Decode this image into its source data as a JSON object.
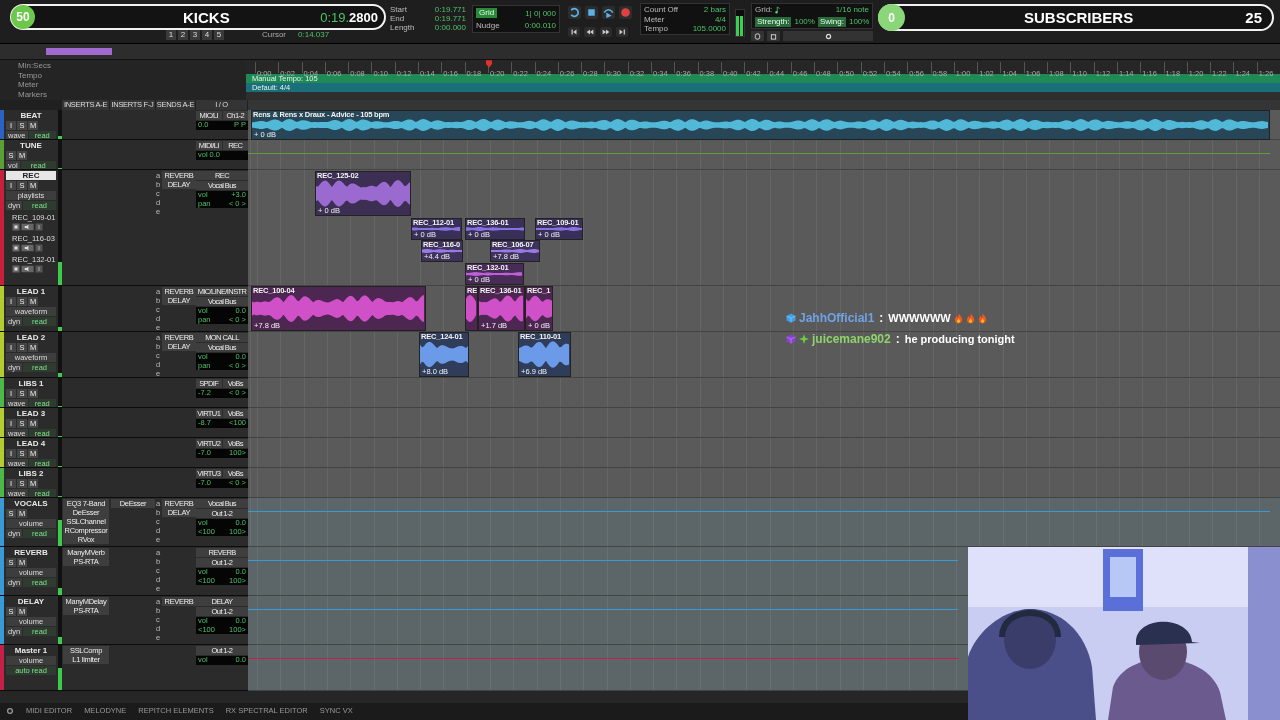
{
  "toolbar": {
    "edit_tools": [
      "1",
      "2",
      "3",
      "4",
      "5"
    ],
    "counter": {
      "main": "0:19.",
      "fraction": "2800"
    },
    "cursor": {
      "label": "Cursor",
      "value": "0:14.037"
    },
    "selection": [
      {
        "label": "Start",
        "value": "0:19.771"
      },
      {
        "label": "End",
        "value": "0:19.771"
      },
      {
        "label": "Length",
        "value": "0:00.000"
      }
    ],
    "grid": {
      "label": "Grid",
      "value": "1| 0| 000"
    },
    "nudge": {
      "label": "Nudge",
      "value": "0:00.010"
    },
    "count_off": [
      {
        "label": "Count Off",
        "value": "2 bars"
      },
      {
        "label": "Meter",
        "value": "4/4"
      },
      {
        "label": "Tempo",
        "value": "105.0000"
      }
    ],
    "level": 0.78,
    "midi_grid": {
      "label": "Grid:",
      "value": "1/16 note"
    },
    "strength": {
      "label": "Strength:",
      "value": "100%"
    },
    "swing": {
      "label": "Swing:",
      "value": "100%"
    }
  },
  "stream_overlay": {
    "goal_count": "50",
    "goal_label": "KICKS",
    "subs_count": "0",
    "subs_label": "SUBSCRIBERS",
    "subs_goal": "25"
  },
  "ruler": {
    "labels": [
      "Min:Secs",
      "Tempo",
      "Meter",
      "Markers"
    ],
    "ticks": [
      "0:00",
      "0:02",
      "0:04",
      "0:06",
      "0:08",
      "0:10",
      "0:12",
      "0:14",
      "0:16",
      "0:18",
      "0:20",
      "0:22",
      "0:24",
      "0:26",
      "0:28",
      "0:30",
      "0:32",
      "0:34",
      "0:36",
      "0:38",
      "0:40",
      "0:42",
      "0:44",
      "0:46",
      "0:48",
      "0:50",
      "0:52",
      "0:54",
      "0:56",
      "0:58",
      "1:00",
      "1:02",
      "1:04",
      "1:06",
      "1:08",
      "1:10",
      "1:12",
      "1:14",
      "1:16",
      "1:18",
      "1:20",
      "1:22",
      "1:24",
      "1:26"
    ],
    "tempo": "Manual Tempo: 105",
    "meter": "Default: 4/4"
  },
  "columns": [
    "INSERTS A-E",
    "INSERTS F-J",
    "SENDS A-E",
    "I / O"
  ],
  "tracks": [
    {
      "name": "BEAT",
      "color": "#2b63c4",
      "kind": "compact",
      "selected": false,
      "level": 0.1,
      "buttons": [
        "I",
        "S",
        "M"
      ],
      "view": "wave",
      "automation": "read",
      "input": "MIC/LI",
      "output": "Ch1-2",
      "readouts": [
        {
          "value": "0.0"
        },
        {
          "value": "P P"
        }
      ],
      "clips": [
        {
          "name": "Rens & Rens x Draux - Advice - 105 bpm",
          "gain": "+ 0 dB",
          "color": "#52b8d8"
        }
      ]
    },
    {
      "name": "TUNE",
      "color": "#5aa032",
      "kind": "compact",
      "selected": false,
      "level": 0.05,
      "buttons": [
        "S",
        "M"
      ],
      "view": "vol",
      "automation": "read",
      "input": "MIDI/LI",
      "output": "REC",
      "readouts": [
        {
          "label": "vol",
          "value": "0.0"
        }
      ],
      "volume_line": true
    },
    {
      "name": "REC",
      "color": "#c8203c",
      "kind": "full",
      "selected": true,
      "level": 0.2,
      "buttons": [
        "I",
        "S",
        "M"
      ],
      "view": "playlists",
      "dyn": "dyn",
      "automation": "read",
      "sends": [
        {
          "slot": "a",
          "name": "REVERB"
        },
        {
          "slot": "b",
          "name": "DELAY"
        },
        {
          "slot": "c"
        },
        {
          "slot": "d"
        },
        {
          "slot": "e"
        }
      ],
      "input": "REC",
      "output": "Vocal Bus",
      "readouts": [
        {
          "label": "vol",
          "value": "+3.0"
        },
        {
          "label": "pan",
          "value": "< 0 >"
        }
      ],
      "playlists": [
        "REC_109-01",
        "REC_116-03",
        "REC_132-01"
      ],
      "clips": [
        {
          "name": "REC_125-02",
          "gain": "+ 0 dB",
          "color": "#9a6ad0"
        },
        {
          "name": "REC_112-01",
          "gain": "+ 0 dB",
          "color": "#8a70e0"
        },
        {
          "name": "REC_136-01",
          "gain": "+ 0 dB",
          "color": "#8a70e0"
        },
        {
          "name": "REC_109-01",
          "gain": "+ 0 dB",
          "color": "#8a70e0"
        },
        {
          "name": "REC_116-0",
          "gain": "+4.4 dB",
          "color": "#9a78e8"
        },
        {
          "name": "REC_106-07",
          "gain": "+7.8 dB",
          "color": "#9a78e8"
        },
        {
          "name": "REC_132-01",
          "gain": "+ 0 dB",
          "color": "#c060d8"
        }
      ]
    },
    {
      "name": "LEAD 1",
      "color": "#b4cc30",
      "kind": "full",
      "selected": false,
      "level": 0.1,
      "buttons": [
        "I",
        "S",
        "M"
      ],
      "view": "waveform",
      "dyn": "dyn",
      "automation": "read",
      "sends": [
        {
          "slot": "a",
          "name": "REVERB"
        },
        {
          "slot": "b",
          "name": "DELAY"
        },
        {
          "slot": "c"
        },
        {
          "slot": "d"
        },
        {
          "slot": "e"
        }
      ],
      "input": "MIC/LINE/INSTR",
      "output": "Vocal Bus",
      "readouts": [
        {
          "label": "vol",
          "value": "0.0"
        },
        {
          "label": "pan",
          "value": "< 0 >"
        }
      ],
      "clips": [
        {
          "name": "REC_100-04",
          "gain": "+7.8 dB",
          "color": "#d050c8"
        },
        {
          "name": "RE",
          "color": "#d050c8"
        },
        {
          "name": "REC_136-01",
          "gain": "+1.7 dB",
          "color": "#d050c8"
        },
        {
          "name": "REC_1",
          "gain": "+ 0 dB",
          "color": "#d050c8"
        }
      ]
    },
    {
      "name": "LEAD 2",
      "color": "#b4cc30",
      "kind": "full",
      "selected": false,
      "level": 0.1,
      "buttons": [
        "I",
        "S",
        "M"
      ],
      "view": "waveform",
      "dyn": "dyn",
      "automation": "read",
      "sends": [
        {
          "slot": "a",
          "name": "REVERB"
        },
        {
          "slot": "b",
          "name": "DELAY"
        },
        {
          "slot": "c"
        },
        {
          "slot": "d"
        },
        {
          "slot": "e"
        }
      ],
      "input": "MON CALL",
      "output": "Vocal Bus",
      "readouts": [
        {
          "label": "vol",
          "value": "0.0"
        },
        {
          "label": "pan",
          "value": "< 0 >"
        }
      ],
      "clips": [
        {
          "name": "REC_124-01",
          "gain": "+8.0 dB",
          "color": "#6a9ae8"
        },
        {
          "name": "REC_110-01",
          "gain": "+6.9 dB",
          "color": "#6a9ae8"
        }
      ]
    },
    {
      "name": "LIBS 1",
      "color": "#4cb848",
      "kind": "compact",
      "selected": false,
      "level": 0.05,
      "buttons": [
        "I",
        "S",
        "M"
      ],
      "view": "wave",
      "automation": "read",
      "input": "SPDIF",
      "output": "VoBs",
      "readouts": [
        {
          "value": "-7.2"
        },
        {
          "value": "< 0 >"
        }
      ]
    },
    {
      "name": "LEAD 3",
      "color": "#b4cc30",
      "kind": "compact",
      "selected": false,
      "level": 0.05,
      "buttons": [
        "I",
        "S",
        "M"
      ],
      "view": "wave",
      "automation": "read",
      "input": "VIRTU1",
      "output": "VoBs",
      "readouts": [
        {
          "value": "-8.7"
        },
        {
          "value": "<100"
        }
      ]
    },
    {
      "name": "LEAD 4",
      "color": "#b4cc30",
      "kind": "compact",
      "selected": false,
      "level": 0.05,
      "buttons": [
        "I",
        "S",
        "M"
      ],
      "view": "wave",
      "automation": "read",
      "input": "VIRTU2",
      "output": "VoBs",
      "readouts": [
        {
          "value": "-7.0"
        },
        {
          "value": "100>"
        }
      ]
    },
    {
      "name": "LIBS 2",
      "color": "#4cb848",
      "kind": "compact",
      "selected": false,
      "level": 0.05,
      "buttons": [
        "I",
        "S",
        "M"
      ],
      "view": "wave",
      "automation": "read",
      "input": "VIRTU3",
      "output": "VoBs",
      "readouts": [
        {
          "value": "-7.0"
        },
        {
          "value": "< 0 >"
        }
      ]
    },
    {
      "name": "VOCALS",
      "color": "#3a9ad8",
      "kind": "aux",
      "selected": false,
      "level": 0.55,
      "buttons": [
        "S",
        "M"
      ],
      "view": "volume",
      "dyn": "dyn",
      "automation": "read",
      "inserts": [
        "EQ3 7-Band",
        "DeEsser",
        "SSLChannel",
        "RCompressor",
        "RVox"
      ],
      "inserts_fj": [
        "DeEsser"
      ],
      "sends": [
        {
          "slot": "a",
          "name": "REVERB"
        },
        {
          "slot": "b",
          "name": "DELAY"
        },
        {
          "slot": "c"
        },
        {
          "slot": "d"
        },
        {
          "slot": "e"
        }
      ],
      "input": "Vocal Bus",
      "output": "Out 1-2",
      "readouts": [
        {
          "label": "vol",
          "value": "0.0"
        },
        {
          "label": "<100",
          "value": "100>"
        }
      ],
      "volume_line": true
    },
    {
      "name": "REVERB",
      "color": "#3a9ad8",
      "kind": "aux",
      "selected": false,
      "level": 0.15,
      "buttons": [
        "S",
        "M"
      ],
      "view": "volume",
      "dyn": "dyn",
      "automation": "read",
      "inserts": [
        "ManyMVerb",
        "PS-RTA"
      ],
      "sends": [
        {
          "slot": "a"
        },
        {
          "slot": "b"
        },
        {
          "slot": "c"
        },
        {
          "slot": "d"
        },
        {
          "slot": "e"
        }
      ],
      "input": "REVERB",
      "output": "Out 1-2",
      "readouts": [
        {
          "label": "vol",
          "value": "0.0"
        },
        {
          "label": "<100",
          "value": "100>"
        }
      ],
      "volume_line": true
    },
    {
      "name": "DELAY",
      "color": "#3a9ad8",
      "kind": "aux",
      "selected": false,
      "level": 0.15,
      "buttons": [
        "S",
        "M"
      ],
      "view": "volume",
      "dyn": "dyn",
      "automation": "read",
      "inserts": [
        "ManyMDelay",
        "PS-RTA"
      ],
      "sends": [
        {
          "slot": "a",
          "name": "REVERB"
        },
        {
          "slot": "b"
        },
        {
          "slot": "c"
        },
        {
          "slot": "d"
        },
        {
          "slot": "e"
        }
      ],
      "input": "DELAY",
      "output": "Out 1-2",
      "readouts": [
        {
          "label": "vol",
          "value": "0.0"
        },
        {
          "label": "<100",
          "value": "100>"
        }
      ],
      "volume_line": true
    },
    {
      "name": "Master 1",
      "color": "#c42048",
      "kind": "master",
      "selected": false,
      "level": 0.5,
      "view": "volume",
      "automation": "auto read",
      "inserts": [
        "SSLComp",
        "L1 limiter"
      ],
      "output": "Out 1-2",
      "readouts": [
        {
          "label": "vol",
          "value": "0.0"
        }
      ],
      "volume_line": true
    }
  ],
  "chat": [
    {
      "user": "JahhOfficial1",
      "color": "#6fa3e6",
      "separator": ":",
      "message": "WWWWWW"
    },
    {
      "user": "juicemane902",
      "color": "#8ed46a",
      "separator": ":",
      "message": "he producing tonight"
    }
  ],
  "bottom_tabs": [
    "MIDI EDITOR",
    "MELODYNE",
    "REPITCH ELEMENTS",
    "RX SPECTRAL EDITOR",
    "SYNC VX"
  ],
  "webcam": {
    "kind": "picture"
  }
}
